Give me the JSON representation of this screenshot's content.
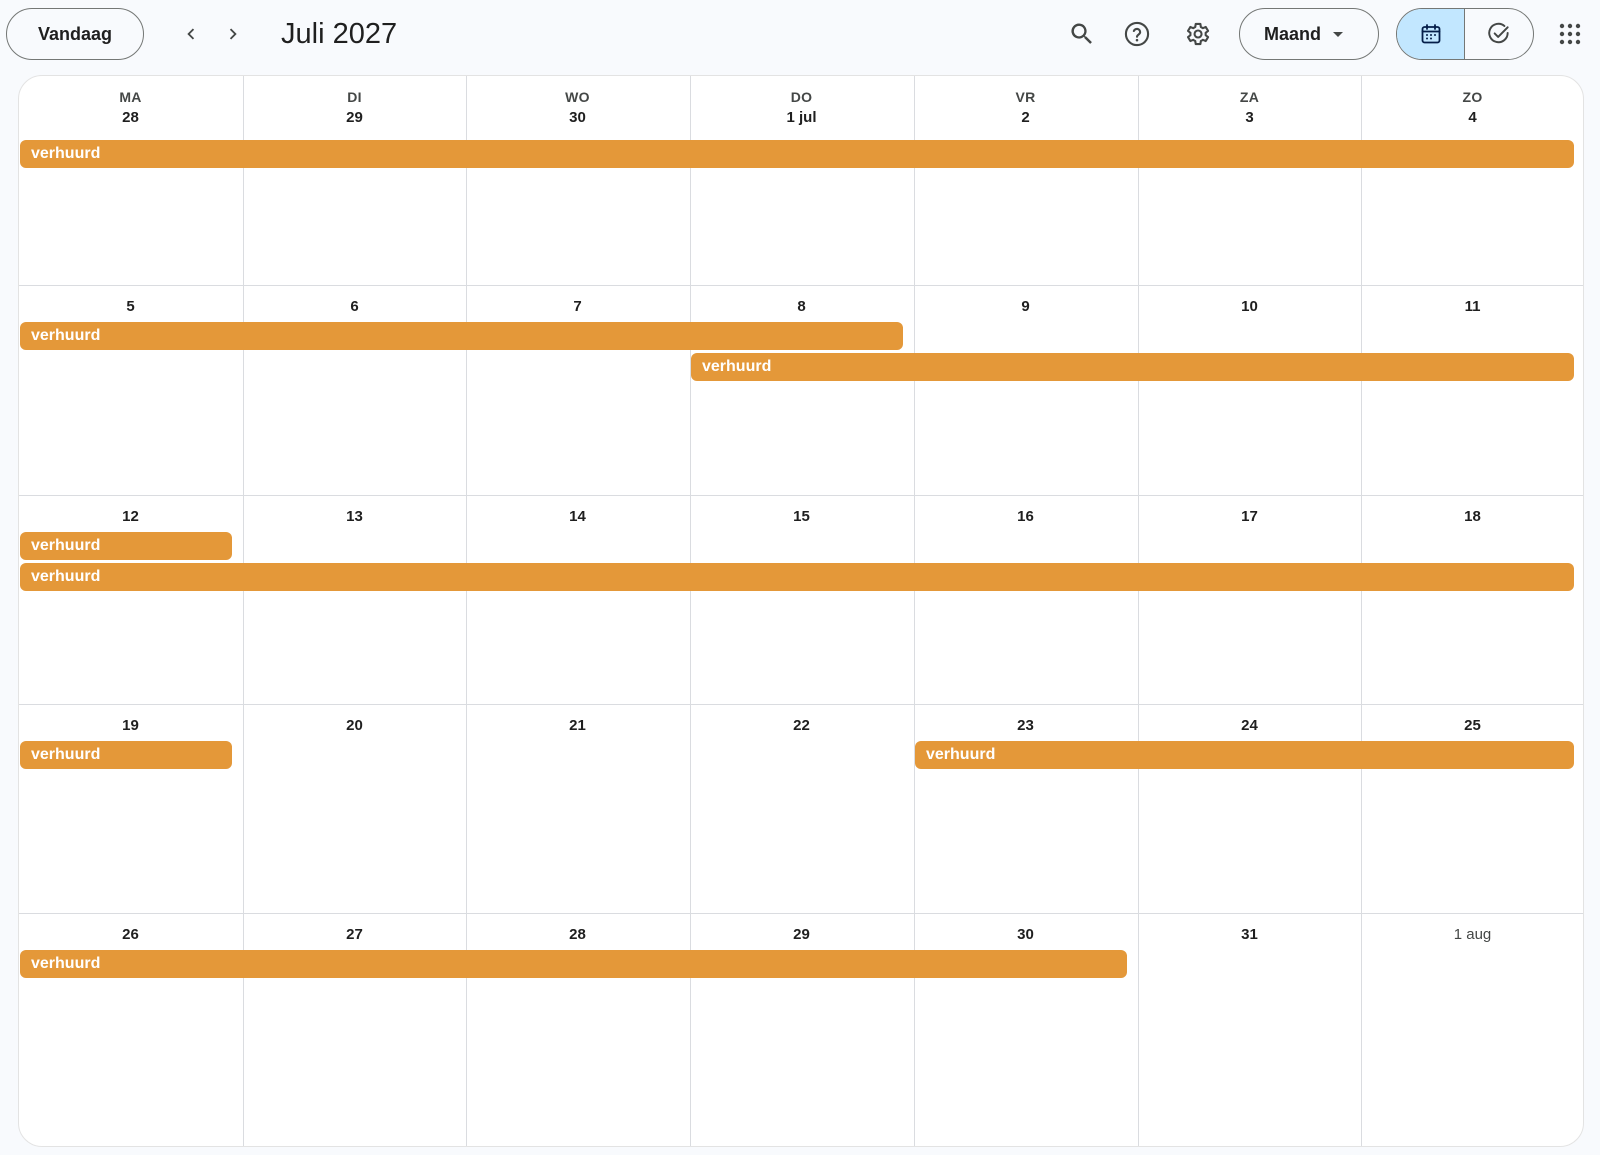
{
  "header": {
    "today_label": "Vandaag",
    "title": "Juli 2027",
    "view_label": "Maand",
    "icons": {
      "prev": "chevron-left-icon",
      "next": "chevron-right-icon",
      "search": "search-icon",
      "help": "help-icon",
      "settings": "gear-icon",
      "calendar": "calendar-icon",
      "tasks": "check-circle-icon",
      "apps": "apps-grid-icon"
    }
  },
  "calendar": {
    "weekdays": [
      "MA",
      "DI",
      "WO",
      "DO",
      "VR",
      "ZA",
      "ZO"
    ],
    "weeks": [
      [
        "28",
        "29",
        "30",
        "1 jul",
        "2",
        "3",
        "4"
      ],
      [
        "5",
        "6",
        "7",
        "8",
        "9",
        "10",
        "11"
      ],
      [
        "12",
        "13",
        "14",
        "15",
        "16",
        "17",
        "18"
      ],
      [
        "19",
        "20",
        "21",
        "22",
        "23",
        "24",
        "25"
      ],
      [
        "26",
        "27",
        "28",
        "29",
        "30",
        "31",
        "1 aug"
      ]
    ],
    "other_month_days": [
      "1 aug"
    ],
    "event_color": "#e49839",
    "events": [
      {
        "title": "verhuurd",
        "week": 0,
        "start": 0,
        "end": 6,
        "lane": 0
      },
      {
        "title": "verhuurd",
        "week": 1,
        "start": 0,
        "end": 3,
        "lane": 0
      },
      {
        "title": "verhuurd",
        "week": 1,
        "start": 3,
        "end": 6,
        "lane": 1
      },
      {
        "title": "verhuurd",
        "week": 2,
        "start": 0,
        "end": 0,
        "lane": 0
      },
      {
        "title": "verhuurd",
        "week": 2,
        "start": 0,
        "end": 6,
        "lane": 1
      },
      {
        "title": "verhuurd",
        "week": 3,
        "start": 0,
        "end": 0,
        "lane": 0
      },
      {
        "title": "verhuurd",
        "week": 3,
        "start": 4,
        "end": 6,
        "lane": 0
      },
      {
        "title": "verhuurd",
        "week": 4,
        "start": 0,
        "end": 4,
        "lane": 0
      }
    ]
  }
}
